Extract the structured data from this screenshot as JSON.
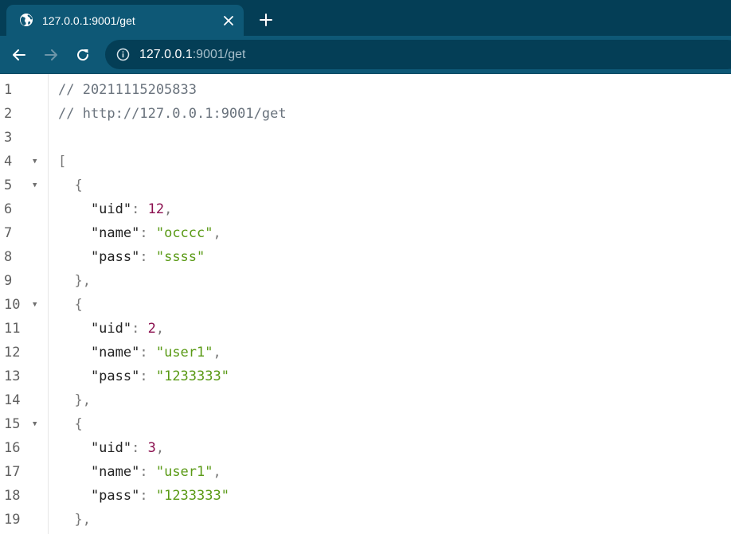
{
  "browser": {
    "tab": {
      "title": "127.0.0.1:9001/get",
      "favicon": "globe-icon"
    },
    "omnibox": {
      "host": "127.0.0.1",
      "rest": ":9001/get"
    },
    "colors": {
      "tabbar": "#043e56",
      "toolbar": "#0e5876",
      "omnibox": "#043e56"
    }
  },
  "viewer": {
    "colors": {
      "comment": "#6a737d",
      "number": "#8b0f4f",
      "string": "#5a9a16",
      "punct": "#7a7a7a",
      "line_number": "#5f5f5f"
    },
    "lines": [
      {
        "n": "1",
        "fold": false,
        "tokens": [
          {
            "t": "// 20211115205833",
            "c": "comment"
          }
        ]
      },
      {
        "n": "2",
        "fold": false,
        "tokens": [
          {
            "t": "// http://127.0.0.1:9001/get",
            "c": "comment"
          }
        ]
      },
      {
        "n": "3",
        "fold": false,
        "tokens": []
      },
      {
        "n": "4",
        "fold": true,
        "tokens": [
          {
            "t": "[",
            "c": "punct"
          }
        ]
      },
      {
        "n": "5",
        "fold": true,
        "tokens": [
          {
            "t": "  {",
            "c": "punct"
          }
        ]
      },
      {
        "n": "6",
        "fold": false,
        "tokens": [
          {
            "t": "    \"uid\"",
            "c": "key"
          },
          {
            "t": ": ",
            "c": "punct"
          },
          {
            "t": "12",
            "c": "num"
          },
          {
            "t": ",",
            "c": "punct"
          }
        ]
      },
      {
        "n": "7",
        "fold": false,
        "tokens": [
          {
            "t": "    \"name\"",
            "c": "key"
          },
          {
            "t": ": ",
            "c": "punct"
          },
          {
            "t": "\"occcc\"",
            "c": "str"
          },
          {
            "t": ",",
            "c": "punct"
          }
        ]
      },
      {
        "n": "8",
        "fold": false,
        "tokens": [
          {
            "t": "    \"pass\"",
            "c": "key"
          },
          {
            "t": ": ",
            "c": "punct"
          },
          {
            "t": "\"ssss\"",
            "c": "str"
          }
        ]
      },
      {
        "n": "9",
        "fold": false,
        "tokens": [
          {
            "t": "  },",
            "c": "punct"
          }
        ]
      },
      {
        "n": "10",
        "fold": true,
        "tokens": [
          {
            "t": "  {",
            "c": "punct"
          }
        ]
      },
      {
        "n": "11",
        "fold": false,
        "tokens": [
          {
            "t": "    \"uid\"",
            "c": "key"
          },
          {
            "t": ": ",
            "c": "punct"
          },
          {
            "t": "2",
            "c": "num"
          },
          {
            "t": ",",
            "c": "punct"
          }
        ]
      },
      {
        "n": "12",
        "fold": false,
        "tokens": [
          {
            "t": "    \"name\"",
            "c": "key"
          },
          {
            "t": ": ",
            "c": "punct"
          },
          {
            "t": "\"user1\"",
            "c": "str"
          },
          {
            "t": ",",
            "c": "punct"
          }
        ]
      },
      {
        "n": "13",
        "fold": false,
        "tokens": [
          {
            "t": "    \"pass\"",
            "c": "key"
          },
          {
            "t": ": ",
            "c": "punct"
          },
          {
            "t": "\"1233333\"",
            "c": "str"
          }
        ]
      },
      {
        "n": "14",
        "fold": false,
        "tokens": [
          {
            "t": "  },",
            "c": "punct"
          }
        ]
      },
      {
        "n": "15",
        "fold": true,
        "tokens": [
          {
            "t": "  {",
            "c": "punct"
          }
        ]
      },
      {
        "n": "16",
        "fold": false,
        "tokens": [
          {
            "t": "    \"uid\"",
            "c": "key"
          },
          {
            "t": ": ",
            "c": "punct"
          },
          {
            "t": "3",
            "c": "num"
          },
          {
            "t": ",",
            "c": "punct"
          }
        ]
      },
      {
        "n": "17",
        "fold": false,
        "tokens": [
          {
            "t": "    \"name\"",
            "c": "key"
          },
          {
            "t": ": ",
            "c": "punct"
          },
          {
            "t": "\"user1\"",
            "c": "str"
          },
          {
            "t": ",",
            "c": "punct"
          }
        ]
      },
      {
        "n": "18",
        "fold": false,
        "tokens": [
          {
            "t": "    \"pass\"",
            "c": "key"
          },
          {
            "t": ": ",
            "c": "punct"
          },
          {
            "t": "\"1233333\"",
            "c": "str"
          }
        ]
      },
      {
        "n": "19",
        "fold": false,
        "tokens": [
          {
            "t": "  },",
            "c": "punct"
          }
        ]
      }
    ]
  }
}
